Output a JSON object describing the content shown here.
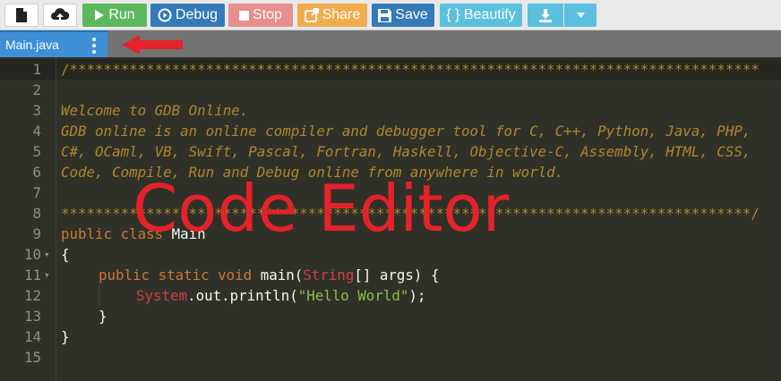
{
  "toolbar": {
    "new_icon": "new-file-icon",
    "upload_icon": "upload-icon",
    "run_label": "Run",
    "debug_label": "Debug",
    "stop_label": "Stop",
    "share_label": "Share",
    "save_label": "Save",
    "beautify_label": "{ } Beautify",
    "download_icon": "download-icon",
    "dropdown_icon": "caret-down-icon"
  },
  "tab": {
    "filename": "Main.java",
    "menu_icon": "vertical-dots-icon"
  },
  "annotation": {
    "label": "Code Editor",
    "arrow_icon": "red-arrow-icon",
    "color": "#e5222a"
  },
  "editor": {
    "line_numbers": [
      "1",
      "2",
      "3",
      "4",
      "5",
      "6",
      "7",
      "8",
      "9",
      "10",
      "11",
      "12",
      "13",
      "14",
      "15"
    ],
    "line1": "/*********************************************************************************",
    "line3": "Welcome to GDB Online.",
    "line4": "GDB online is an online compiler and debugger tool for C, C++, Python, Java, PHP,",
    "line5": "C#, OCaml, VB, Swift, Pascal, Fortran, Haskell, Objective-C, Assembly, HTML, CSS,",
    "line6": "Code, Compile, Run and Debug online from anywhere in world.",
    "line8": "*********************************************************************************/",
    "line9_kw": "public class ",
    "line9_name": "Main",
    "line10": "{",
    "line11_kw": "public static void ",
    "line11_name": "main(",
    "line11_type": "String",
    "line11_rest": "[] args) {",
    "line12_type": "System",
    "line12_mid": ".out.println(",
    "line12_str": "\"Hello World\"",
    "line12_end": ");",
    "line13": "}",
    "line14": "}"
  },
  "colors": {
    "run": "#5cb85c",
    "debug": "#337ab7",
    "stop": "#e88e8e",
    "share": "#f0ad4e",
    "save": "#337ab7",
    "beautify": "#5bc0de",
    "tab": "#3d8fd6",
    "editor_bg": "#2f3129",
    "comment": "#b0862c",
    "keyword": "#cc7832",
    "string": "#8fbf45"
  }
}
